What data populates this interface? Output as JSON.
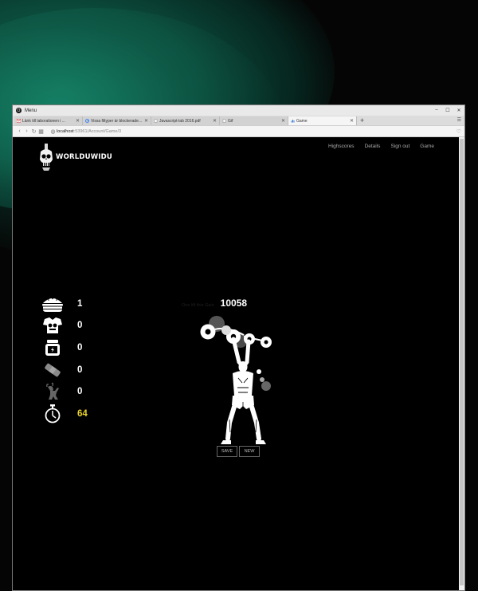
{
  "window": {
    "menu_label": "Menu",
    "controls": [
      "–",
      "☐",
      "✕"
    ]
  },
  "tabs": [
    {
      "title": "Länk till laborationen i ...",
      "favicon": "gmail-icon",
      "active": false
    },
    {
      "title": "Vissa filtyper är blockerade...",
      "favicon": "google-icon",
      "active": false
    },
    {
      "title": "Javascript-lab 2016.pdf",
      "favicon": "document-icon",
      "active": false
    },
    {
      "title": "Gif",
      "favicon": "document-icon",
      "active": false
    },
    {
      "title": "Game",
      "favicon": "chart-icon",
      "active": true
    }
  ],
  "address": {
    "host": "localhost",
    "path": ":53961/Account/Game/3"
  },
  "site": {
    "logo_text": "WORLDUWIDU",
    "nav": [
      "Highscores",
      "Details",
      "Sign out",
      "Game"
    ]
  },
  "stats": [
    {
      "icon": "burger-icon",
      "value": "1"
    },
    {
      "icon": "muscle-shirt-icon",
      "value": "0"
    },
    {
      "icon": "protein-jar-icon",
      "value": "0"
    },
    {
      "icon": "bandage-icon",
      "value": "0"
    },
    {
      "icon": "flexing-goat-icon",
      "value": "0"
    },
    {
      "icon": "stopwatch-icon",
      "value": "64"
    }
  ],
  "score": {
    "label": "One lift this Gain",
    "value": "10058"
  },
  "buttons": {
    "save": "SAVE",
    "new": "NEW"
  },
  "colors": {
    "background": "#000000",
    "accent_glow": "#0f5c49",
    "timer": "#e8d22c"
  }
}
